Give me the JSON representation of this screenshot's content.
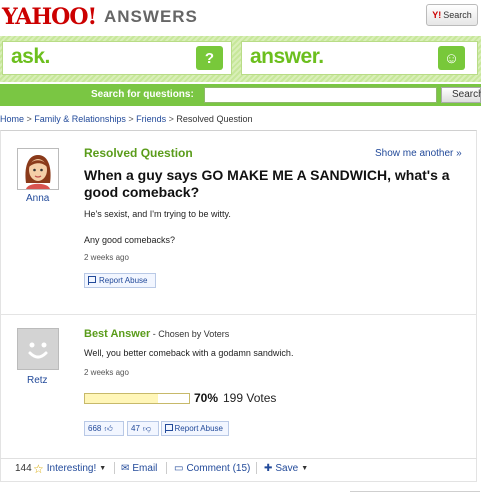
{
  "brand": {
    "logo": "YAHOO!",
    "product": "ANSWERS",
    "search_button": "Search"
  },
  "cta": {
    "ask": "ask.",
    "answer": "answer."
  },
  "search": {
    "label": "Search for questions:",
    "placeholder": "",
    "button": "Search"
  },
  "breadcrumb": [
    "Home",
    "Family & Relationships",
    "Friends",
    "Resolved Question"
  ],
  "question": {
    "heading": "Resolved Question",
    "show_another": "Show me another »",
    "title": "When a guy says GO MAKE ME A SANDWICH, what's a good comeback?",
    "body_1": "He's sexist, and I'm trying to be witty.",
    "body_2": "Any good comebacks?",
    "time": "2 weeks ago",
    "user": "Anna",
    "report": "Report Abuse"
  },
  "answer": {
    "heading": "Best Answer",
    "chosen_by": " - Chosen by Voters",
    "body": "Well, you better comeback with a godamn sandwich.",
    "time": "2 weeks ago",
    "user": "Retz",
    "vote_percent": "70%",
    "vote_fraction": 0.7,
    "votes": "199 Votes",
    "thumbs_up": "668",
    "thumbs_down": "47",
    "report": "Report Abuse"
  },
  "footer": {
    "count": "144",
    "interesting": "Interesting!",
    "email": "Email",
    "comment": "Comment (15)",
    "save": "Save"
  },
  "colors": {
    "accent_green": "#7ac643",
    "link_blue": "#224a9a",
    "yahoo_red": "#cc0000"
  }
}
